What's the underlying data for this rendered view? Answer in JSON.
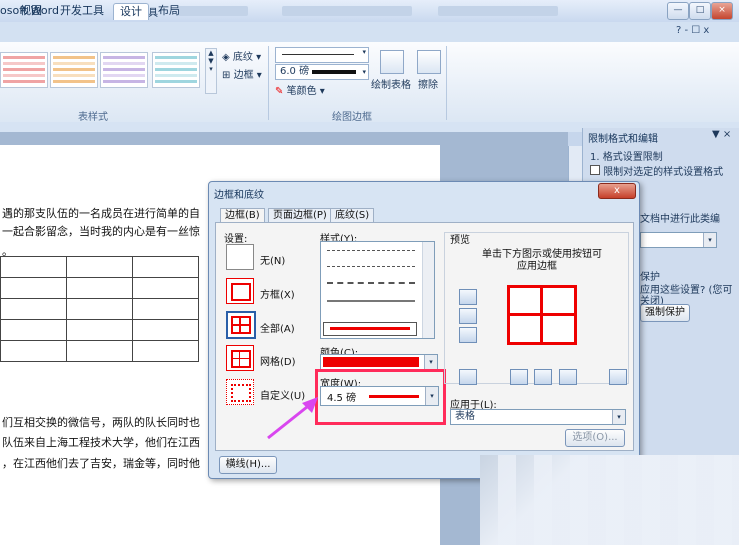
{
  "window": {
    "title": "osoft Word",
    "context_tab": "表格工具",
    "min": "—",
    "max": "□",
    "close": "×"
  },
  "tabs": [
    {
      "label": "视图"
    },
    {
      "label": "开发工具"
    },
    {
      "label": "设计"
    },
    {
      "label": "布局"
    }
  ],
  "tabs_right": "? - ☐ x",
  "ribbon": {
    "shading": "底纹",
    "borders": "边框",
    "line_width": "6.0 磅",
    "pen_color": "笔颜色",
    "draw_table": "绘制表格",
    "erase": "擦除",
    "group_table_styles": "表样式",
    "group_draw_borders": "绘图边框"
  },
  "document": {
    "lines": [
      "遇的那支队伍的一名成员在进行简单的自",
      "一起合影留念，当时我的内心是有一丝惊",
      "。",
      "们互相交换的微信号，两队的队长同时也",
      "队伍来自上海工程技术大学，他们在江西",
      "，在江西他们去了吉安，瑞金等，同时他"
    ]
  },
  "task_pane": {
    "title": "限制格式和编辑",
    "step1": "1. 格式设置限制",
    "checkbox": "限制对选定的样式设置格式",
    "line2": "文档中进行此类编",
    "line3": "保护",
    "line4": "应用这些设置? (您可",
    "line5": "关闭)",
    "button": "强制保护"
  },
  "dialog": {
    "title": "边框和底纹",
    "tabs": [
      "边框(B)",
      "页面边框(P)",
      "底纹(S)"
    ],
    "settings_label": "设置:",
    "settings": [
      "无(N)",
      "方框(X)",
      "全部(A)",
      "网格(D)",
      "自定义(U)"
    ],
    "style_label": "样式(Y):",
    "color_label": "颜色(C):",
    "width_label": "宽度(W):",
    "width_value": "4.5 磅",
    "preview_label": "预览",
    "preview_hint_1": "单击下方图示或使用按钮可",
    "preview_hint_2": "应用边框",
    "apply_label": "应用于(L):",
    "apply_value": "表格",
    "options_button": "选项(O)...",
    "lines_button": "横线(H)...",
    "close_glyph": "x"
  },
  "colors": {
    "accent_red": "#e00000",
    "highlight": "#ff2b5a",
    "arrow": "#d946ef"
  }
}
